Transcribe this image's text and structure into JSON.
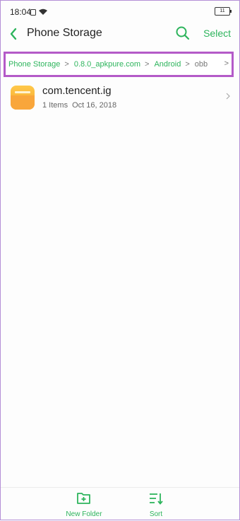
{
  "status_bar": {
    "time": "18:04",
    "battery": "11"
  },
  "header": {
    "title": "Phone Storage",
    "select_label": "Select"
  },
  "breadcrumb": {
    "items": [
      "Phone Storage",
      "0.8.0_apkpure.com",
      "Android",
      "obb"
    ],
    "separator": ">"
  },
  "files": [
    {
      "name": "com.tencent.ig",
      "items": "1 Items",
      "date": "Oct 16, 2018"
    }
  ],
  "toolbar": {
    "new_folder_label": "New Folder",
    "sort_label": "Sort"
  },
  "colors": {
    "accent": "#2db45c",
    "highlight_border": "#b45ac8",
    "folder": "#f9a63b"
  },
  "icons": [
    "wifi-icon",
    "back-arrow-icon",
    "search-icon",
    "folder-icon",
    "new-folder-icon",
    "sort-icon"
  ]
}
